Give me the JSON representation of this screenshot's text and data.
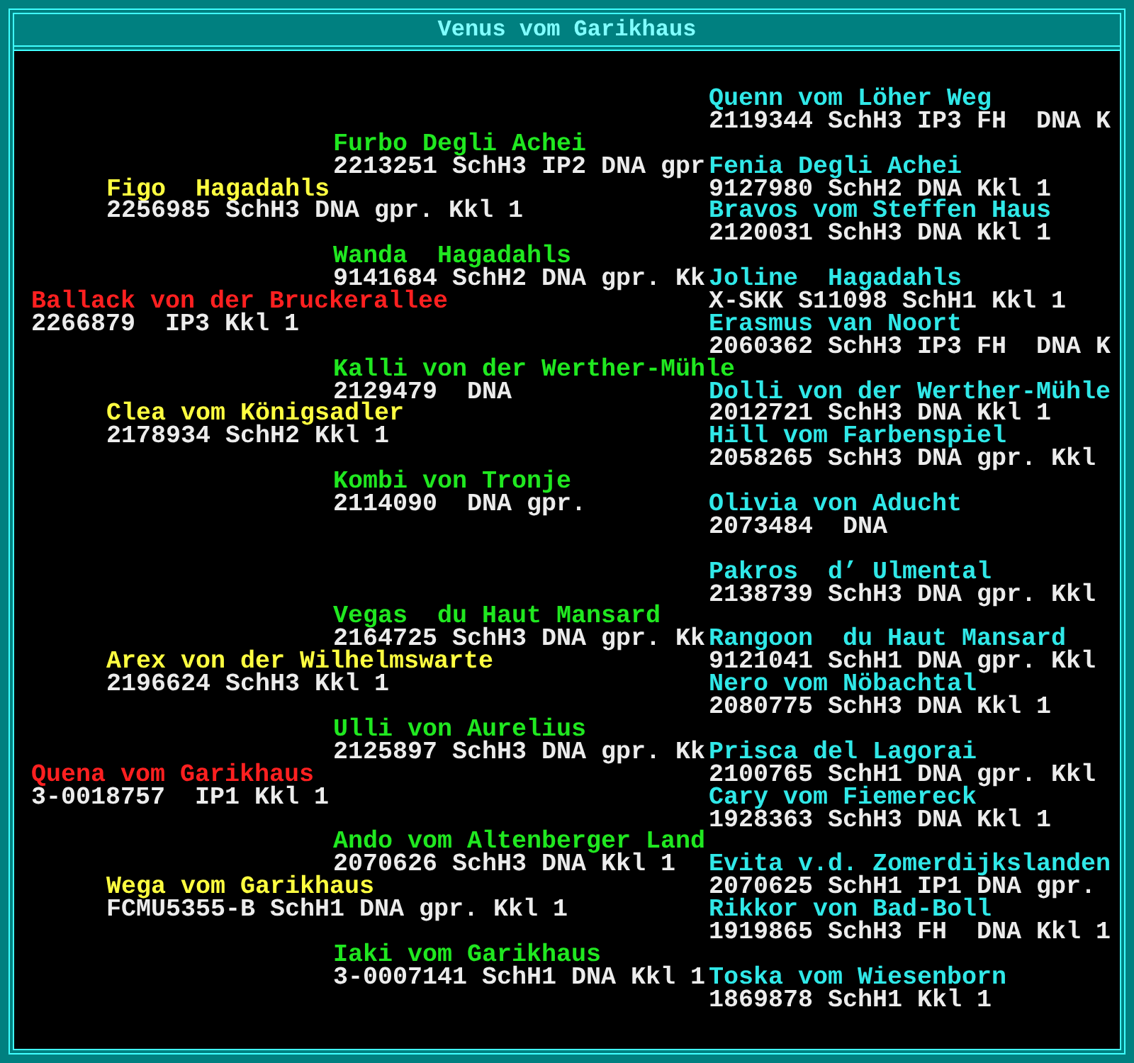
{
  "window": {
    "title": "Venus vom Garikhaus"
  },
  "pedigree": [
    {
      "name": "Ballack von der Bruckerallee",
      "info": "2266879  IP3 Kkl 1",
      "parents": [
        {
          "name": "Figo  Hagadahls",
          "info": "2256985 SchH3 DNA gpr. Kkl 1",
          "parents": [
            {
              "name": "Furbo Degli Achei",
              "info": "2213251 SchH3 IP2 DNA gpr",
              "parents": [
                {
                  "name": "Quenn vom Löher Weg",
                  "info": "2119344 SchH3 IP3 FH  DNA K"
                },
                {
                  "name": "Fenia Degli Achei",
                  "info": "9127980 SchH2 DNA Kkl 1"
                }
              ]
            },
            {
              "name": "Wanda  Hagadahls",
              "info": "9141684 SchH2 DNA gpr. Kk",
              "parents": [
                {
                  "name": "Bravos vom Steffen Haus",
                  "info": "2120031 SchH3 DNA Kkl 1"
                },
                {
                  "name": "Joline  Hagadahls",
                  "info": "X-SKK S11098 SchH1 Kkl 1"
                }
              ]
            }
          ]
        },
        {
          "name": "Clea vom Königsadler",
          "info": "2178934 SchH2 Kkl 1",
          "parents": [
            {
              "name": "Kalli von der Werther-Mühle",
              "info": "2129479  DNA",
              "parents": [
                {
                  "name": "Erasmus van Noort",
                  "info": "2060362 SchH3 IP3 FH  DNA K"
                },
                {
                  "name": "Dolli von der Werther-Mühle",
                  "info": "2012721 SchH3 DNA Kkl 1"
                }
              ]
            },
            {
              "name": "Kombi von Tronje",
              "info": "2114090  DNA gpr.",
              "parents": [
                {
                  "name": "Hill vom Farbenspiel",
                  "info": "2058265 SchH3 DNA gpr. Kkl"
                },
                {
                  "name": "Olivia von Aducht",
                  "info": "2073484  DNA"
                }
              ]
            }
          ]
        }
      ]
    },
    {
      "name": "Quena vom Garikhaus",
      "info": "3-0018757  IP1 Kkl 1",
      "parents": [
        {
          "name": "Arex von der Wilhelmswarte",
          "info": "2196624 SchH3 Kkl 1",
          "parents": [
            {
              "name": "Vegas  du Haut Mansard",
              "info": "2164725 SchH3 DNA gpr. Kk",
              "parents": [
                {
                  "name": "Pakros  d’ Ulmental",
                  "info": "2138739 SchH3 DNA gpr. Kkl"
                },
                {
                  "name": "Rangoon  du Haut Mansard",
                  "info": "9121041 SchH1 DNA gpr. Kkl"
                }
              ]
            },
            {
              "name": "Ulli von Aurelius",
              "info": "2125897 SchH3 DNA gpr. Kk",
              "parents": [
                {
                  "name": "Nero vom Nöbachtal",
                  "info": "2080775 SchH3 DNA Kkl 1"
                },
                {
                  "name": "Prisca del Lagorai",
                  "info": "2100765 SchH1 DNA gpr. Kkl"
                }
              ]
            }
          ]
        },
        {
          "name": "Wega vom Garikhaus",
          "info": "FCMU5355-B SchH1 DNA gpr. Kkl 1",
          "parents": [
            {
              "name": "Ando vom Altenberger Land",
              "info": "2070626 SchH3 DNA Kkl 1",
              "parents": [
                {
                  "name": "Cary vom Fiemereck",
                  "info": "1928363 SchH3 DNA Kkl 1"
                },
                {
                  "name": "Evita v.d. Zomerdijkslanden",
                  "info": "2070625 SchH1 IP1 DNA gpr."
                }
              ]
            },
            {
              "name": "Iaki vom Garikhaus",
              "info": "3-0007141 SchH1 DNA Kkl 1",
              "parents": [
                {
                  "name": "Rikkor von Bad-Boll",
                  "info": "1919865 SchH3 FH  DNA Kkl 1"
                },
                {
                  "name": "Toska vom Wiesenborn",
                  "info": "1869878 SchH1 Kkl 1"
                }
              ]
            }
          ]
        }
      ]
    }
  ]
}
